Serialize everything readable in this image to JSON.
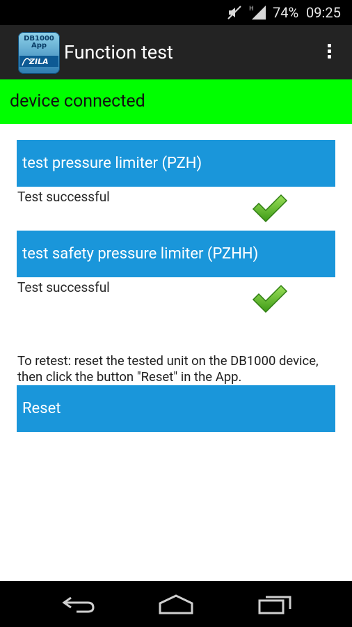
{
  "status_bar": {
    "battery": "74%",
    "time": "09:25",
    "icons": [
      "mute-icon",
      "signal-icon"
    ]
  },
  "action_bar": {
    "app_icon": {
      "line1": "DB1000",
      "line2": "App",
      "brand": "ZILA"
    },
    "title": "Function test",
    "menu_icon": "overflow-menu-icon"
  },
  "banner": {
    "text": "device connected",
    "color": "#00ff00"
  },
  "tests": [
    {
      "label": "test pressure limiter (PZH)",
      "result": "Test successful",
      "icon": "checkmark-icon"
    },
    {
      "label": "test safety pressure limiter (PZHH)",
      "result": "Test successful",
      "icon": "checkmark-icon"
    }
  ],
  "hint": "To retest: reset the tested unit on the DB1000 device, then click the button \"Reset\" in the App.",
  "reset_label": "Reset",
  "colors": {
    "button": "#1a96da",
    "action_bar": "#232323",
    "check": "#5cb82a"
  },
  "nav": [
    "back-icon",
    "home-icon",
    "recent-apps-icon"
  ]
}
